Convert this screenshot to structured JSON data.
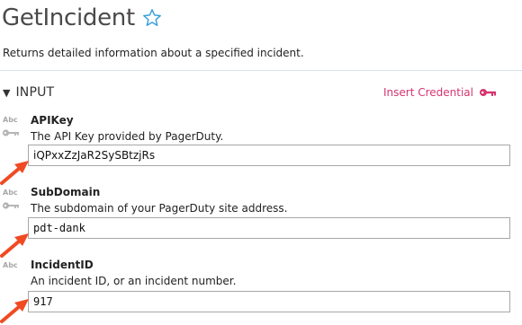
{
  "page": {
    "title": "GetIncident",
    "description": "Returns detailed information about a specified incident."
  },
  "section": {
    "title": "INPUT",
    "insert_credential": "Insert Credential"
  },
  "fields": [
    {
      "type_badge": "Abc",
      "label": "APIKey",
      "description": "The API Key provided by PagerDuty.",
      "value": "iQPxxZzJaR2SySBtzjRs",
      "has_key_icon": true
    },
    {
      "type_badge": "Abc",
      "label": "SubDomain",
      "description": "The subdomain of your PagerDuty site address.",
      "value": "pdt-dank",
      "has_key_icon": true
    },
    {
      "type_badge": "Abc",
      "label": "IncidentID",
      "description": "An incident ID, or an incident number.",
      "value": "917",
      "has_key_icon": false
    }
  ],
  "colors": {
    "accent": "#d6356f",
    "star": "#3ba0d8",
    "arrow": "#f04a23",
    "divider": "#d9e2e8"
  },
  "icons": [
    "star-icon",
    "key-icon",
    "collapse-triangle-icon",
    "arrow-annotation-icon"
  ]
}
